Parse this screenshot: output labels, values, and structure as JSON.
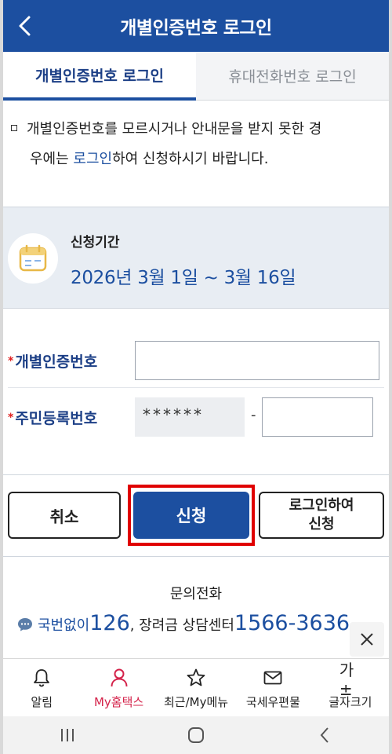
{
  "header": {
    "title": "개별인증번호 로그인"
  },
  "tabs": [
    {
      "label": "개별인증번호 로그인",
      "active": true
    },
    {
      "label": "휴대전화번호 로그인",
      "active": false
    }
  ],
  "notice": {
    "line1": "개별인증번호를 모르시거나 안내문을 받지 못한 경",
    "line2_prefix": "우에는 ",
    "line2_link": "로그인",
    "line2_suffix": "하여 신청하시기 바랍니다."
  },
  "period": {
    "label": "신청기간",
    "value": "2026년 3월 1일 ~ 3월 16일"
  },
  "form": {
    "required_mark": "*",
    "auth_number_label": "개별인증번호",
    "auth_number_value": "",
    "rrn_label": "주민등록번호",
    "rrn_front_masked": "******",
    "rrn_separator": "-",
    "rrn_back_value": ""
  },
  "buttons": {
    "cancel": "취소",
    "apply": "신청",
    "login_apply_line1": "로그인하여",
    "login_apply_line2": "신청"
  },
  "contact": {
    "title": "문의전화",
    "prefix": "국번없이",
    "number1": "126",
    "middle": ", 장려금 상담센터 ",
    "number2": "1566-3636"
  },
  "bottom_nav": [
    {
      "label": "알림",
      "icon": "bell-icon"
    },
    {
      "label": "My홈택스",
      "icon": "person-icon",
      "active": true
    },
    {
      "label": "최근/My메뉴",
      "icon": "star-icon"
    },
    {
      "label": "국세우편물",
      "icon": "mail-icon"
    },
    {
      "label": "글자크기",
      "icon": "font-size-icon",
      "icon_text": "가±"
    }
  ],
  "colors": {
    "primary": "#1c4fa0",
    "highlight": "#e00000",
    "active_nav": "#d4224a"
  }
}
